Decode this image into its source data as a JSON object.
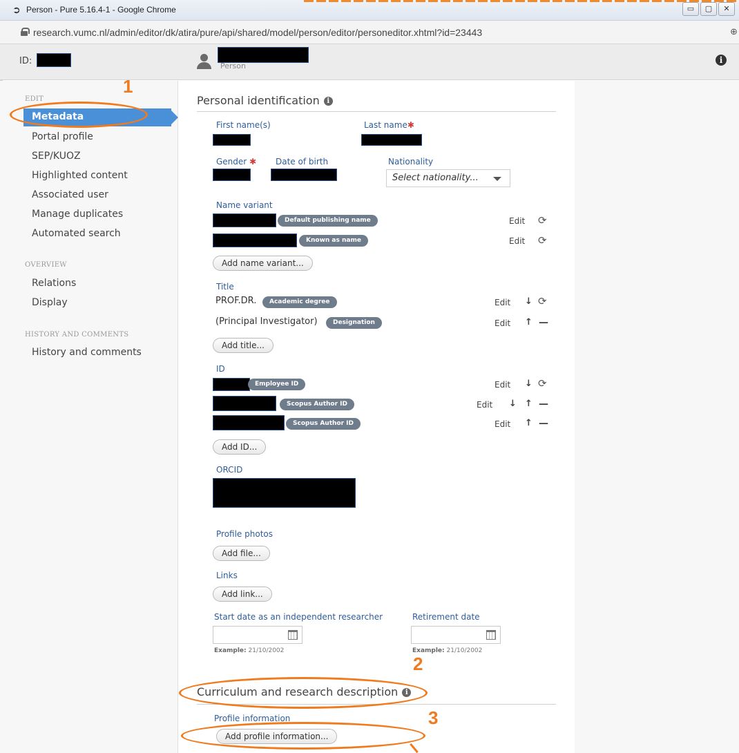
{
  "window": {
    "title": "Person - Pure 5.16.4-1 - Google Chrome",
    "url": "research.vumc.nl/admin/editor/dk/atira/pure/api/shared/model/person/editor/personeditor.xhtml?id=23443",
    "min_glyph": "▭",
    "max_glyph": "▢",
    "close_glyph": "✕",
    "zoom_glyph": "⊕"
  },
  "header": {
    "id_label": "ID:",
    "entity_type": "Person",
    "info_glyph": "i"
  },
  "sidebar": {
    "section_edit": "EDIT",
    "items_edit": [
      "Metadata",
      "Portal profile",
      "SEP/KUOZ",
      "Highlighted content",
      "Associated user",
      "Manage duplicates",
      "Automated search"
    ],
    "section_overview": "OVERVIEW",
    "items_overview": [
      "Relations",
      "Display"
    ],
    "section_history": "HISTORY AND COMMENTS",
    "items_history": [
      "History and comments"
    ]
  },
  "personal": {
    "title": "Personal identification",
    "first_name_label": "First name(s)",
    "last_name_label": "Last name",
    "gender_label": "Gender",
    "dob_label": "Date of birth",
    "nationality_label": "Nationality",
    "nationality_placeholder": "Select nationality...",
    "required_mark": "✱",
    "name_variant_label": "Name variant",
    "name_variants": [
      "Default publishing name",
      "Known as name"
    ],
    "add_name_variant": "Add name variant...",
    "title_label": "Title",
    "titles": [
      {
        "value": "PROF.DR.",
        "badge": "Academic degree"
      },
      {
        "value": "(Principal Investigator)",
        "badge": "Designation"
      }
    ],
    "add_title": "Add title...",
    "id_label": "ID",
    "ids": [
      "Employee ID",
      "Scopus Author ID",
      "Scopus Author ID"
    ],
    "add_id": "Add ID...",
    "orcid_label": "ORCID",
    "profile_photos_label": "Profile photos",
    "add_file": "Add file...",
    "links_label": "Links",
    "add_link": "Add link...",
    "start_date_label": "Start date as an independent researcher",
    "retirement_label": "Retirement date",
    "example_prefix": "Example:",
    "example_value": "21/10/2002",
    "edit": "Edit",
    "up_arrow": "↑",
    "down_arrow": "↓",
    "refresh_glyph": "⟳",
    "remove_glyph": "—"
  },
  "curriculum": {
    "title": "Curriculum and research description",
    "profile_info_label": "Profile information",
    "add_profile_info": "Add profile information..."
  },
  "annotations": {
    "n1": "1",
    "n2": "2",
    "n3": "3",
    "color": "#f07b1f"
  }
}
